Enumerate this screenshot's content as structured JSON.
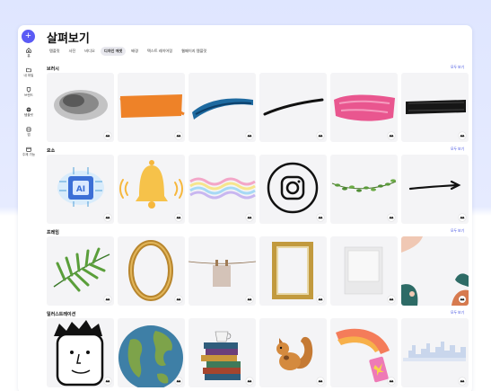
{
  "sidebar": {
    "add_icon": "plus-icon",
    "items": [
      {
        "label": "홈",
        "icon": "home-icon"
      },
      {
        "label": "내 파일",
        "icon": "folder-icon"
      },
      {
        "label": "브랜드",
        "icon": "brand-icon"
      },
      {
        "label": "템플릿",
        "icon": "template-icon"
      },
      {
        "label": "앱",
        "icon": "apps-icon"
      },
      {
        "label": "주제 가능",
        "icon": "calendar-icon"
      }
    ]
  },
  "main": {
    "title": "살펴보기",
    "tabs": [
      {
        "label": "템플릿",
        "active": false
      },
      {
        "label": "사진",
        "active": false
      },
      {
        "label": "비디오",
        "active": false
      },
      {
        "label": "디자인 에셋",
        "active": true
      },
      {
        "label": "배경",
        "active": false
      },
      {
        "label": "텍스트 레이어링",
        "active": false
      },
      {
        "label": "웹페이지 템플릿",
        "active": false
      }
    ],
    "sections": [
      {
        "title": "브러시",
        "more": "모두 보기"
      },
      {
        "title": "요소",
        "more": "모두 보기"
      },
      {
        "title": "프레임",
        "more": "모두 보기"
      },
      {
        "title": "일러스트레이션",
        "more": "모두 보기"
      }
    ]
  },
  "colors": {
    "accent": "#5b5bf5",
    "link": "#3c4be0"
  }
}
